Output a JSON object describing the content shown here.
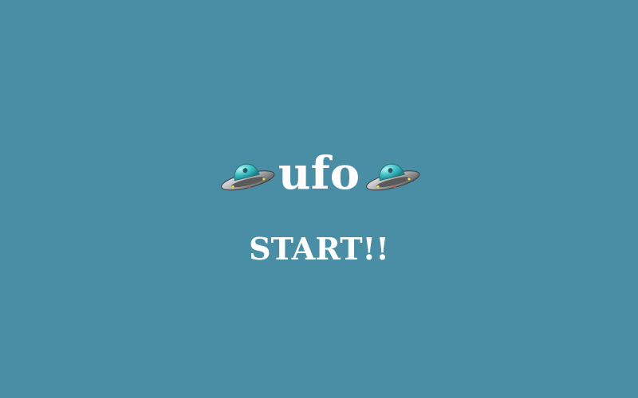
{
  "game": {
    "title": "ufo",
    "start_label": "START!!",
    "icons": {
      "left": "ufo-icon",
      "right": "ufo-icon"
    },
    "colors": {
      "background": "#4a8ea6",
      "text": "#ffffff",
      "ufo_dome": "#3fc3c9",
      "ufo_body": "#b8b8b8"
    }
  }
}
